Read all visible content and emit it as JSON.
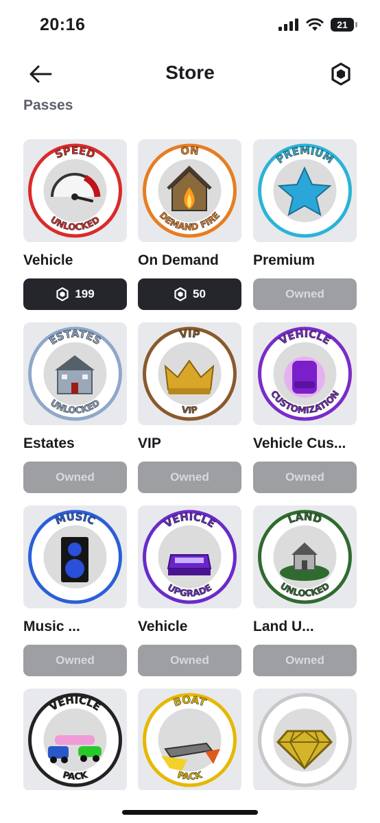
{
  "status_bar": {
    "time": "20:16",
    "battery": "21"
  },
  "nav": {
    "title": "Store"
  },
  "section": {
    "title": "Passes"
  },
  "items": [
    {
      "name": "Vehicle",
      "price": "199",
      "state": "buy",
      "icon": "speed-unlocked-gauge-icon",
      "ring": "#d92b2b",
      "top_label": "SPEED",
      "bottom_label": "UNLOCKED"
    },
    {
      "name": "On Demand",
      "price": "50",
      "state": "buy",
      "icon": "burning-house-icon",
      "ring": "#e67e22",
      "top_label": "ON",
      "bottom_label": "DEMAND FIRE"
    },
    {
      "name": "Premium",
      "owned": "Owned",
      "state": "owned",
      "icon": "star-icon",
      "ring": "#2bb3d6",
      "top_label": "PREMIUM",
      "bottom_label": ""
    },
    {
      "name": "Estates",
      "owned": "Owned",
      "state": "owned",
      "icon": "mansion-icon",
      "ring": "#8fa7c9",
      "top_label": "ESTATES",
      "bottom_label": "UNLOCKED"
    },
    {
      "name": "VIP",
      "owned": "Owned",
      "state": "owned",
      "icon": "crown-icon",
      "ring": "#8b5a2b",
      "top_label": "VIP",
      "bottom_label": "VIP"
    },
    {
      "name": "Vehicle Cus...",
      "owned": "Owned",
      "state": "owned",
      "icon": "vehicle-customization-icon",
      "ring": "#7a2bc9",
      "top_label": "VEHICLE",
      "bottom_label": "CUSTOMIZATION"
    },
    {
      "name": "Music ...",
      "owned": "Owned",
      "state": "owned",
      "icon": "speaker-icon",
      "ring": "#2b5fd9",
      "top_label": "MUSIC",
      "bottom_label": ""
    },
    {
      "name": "Vehicle",
      "owned": "Owned",
      "state": "owned",
      "icon": "vehicle-upgrade-icon",
      "ring": "#6a2bc9",
      "top_label": "VEHICLE",
      "bottom_label": "UPGRADE"
    },
    {
      "name": "Land U...",
      "owned": "Owned",
      "state": "owned",
      "icon": "land-house-icon",
      "ring": "#2f6b2f",
      "top_label": "LAND",
      "bottom_label": "UNLOCKED"
    },
    {
      "name": "",
      "state": "none",
      "icon": "vehicle-pack-icon",
      "ring": "#222222",
      "top_label": "VEHICLE",
      "bottom_label": "PACK"
    },
    {
      "name": "",
      "state": "none",
      "icon": "boat-pack-icon",
      "ring": "#e6b800",
      "top_label": "BOAT",
      "bottom_label": "PACK"
    },
    {
      "name": "",
      "state": "none",
      "icon": "diamond-icon",
      "ring": "#c8c8c8",
      "top_label": "",
      "bottom_label": ""
    }
  ]
}
